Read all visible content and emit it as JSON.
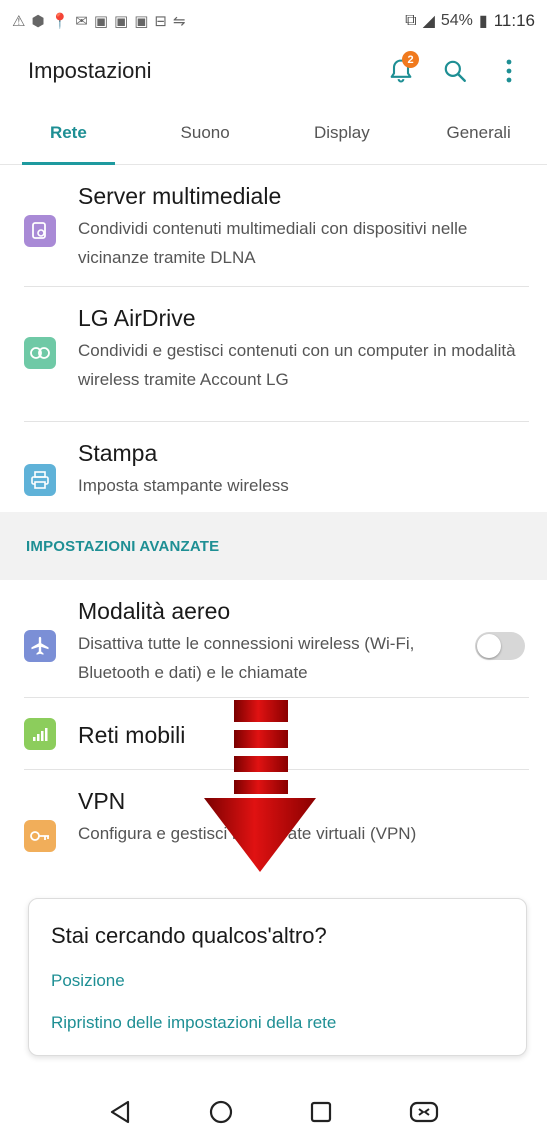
{
  "status_bar": {
    "battery": "54%",
    "time": "11:16"
  },
  "header": {
    "title": "Impostazioni",
    "notification_count": "2",
    "accent_color": "#1e8f94"
  },
  "tabs": [
    {
      "label": "Rete",
      "active": true
    },
    {
      "label": "Suono",
      "active": false
    },
    {
      "label": "Display",
      "active": false
    },
    {
      "label": "Generali",
      "active": false
    }
  ],
  "items": [
    {
      "title": "Server multimediale",
      "subtitle": "Condividi contenuti multimediali con dispositivi nelle vicinanze tramite DLNA",
      "icon": "media-server-icon"
    },
    {
      "title": "LG AirDrive",
      "subtitle": "Condividi e gestisci contenuti con un computer in modalità wireless tramite Account LG",
      "icon": "airdrive-icon"
    },
    {
      "title": "Stampa",
      "subtitle": "Imposta stampante wireless",
      "icon": "printer-icon"
    }
  ],
  "section_header": "IMPOSTAZIONI AVANZATE",
  "advanced": [
    {
      "title": "Modalità aereo",
      "subtitle": "Disattiva tutte le connessioni wireless (Wi-Fi, Bluetooth e dati) e le chiamate",
      "icon": "airplane-icon",
      "toggle": "off"
    },
    {
      "title": "Reti mobili",
      "subtitle": "",
      "icon": "signal-icon"
    },
    {
      "title": "VPN",
      "subtitle": "Configura e gestisci reti private virtuali (VPN)",
      "icon": "vpn-key-icon"
    }
  ],
  "help_card": {
    "heading": "Stai cercando qualcos'altro?",
    "links": [
      "Posizione",
      "Ripristino delle impostazioni della rete"
    ]
  }
}
